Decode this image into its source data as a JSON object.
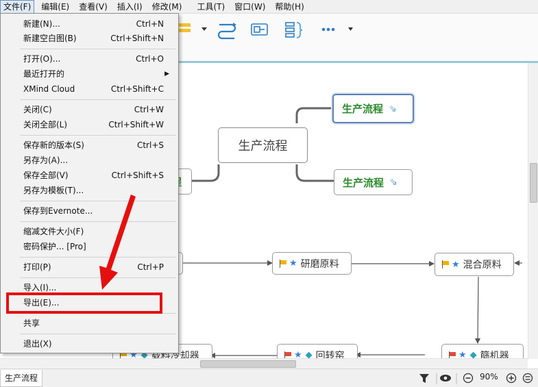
{
  "menubar": {
    "items": [
      "文件(F)",
      "编辑(E)",
      "查看(V)",
      "插入(I)",
      "修改(M)",
      "工具(T)",
      "窗口(W)",
      "帮助(H)"
    ]
  },
  "file_menu": {
    "items": [
      {
        "label": "新建(N)...",
        "shortcut": "Ctrl+N"
      },
      {
        "label": "新建空白图(B)",
        "shortcut": "Ctrl+Shift+N"
      },
      {
        "label": "打开(O)...",
        "shortcut": "Ctrl+O"
      },
      {
        "label": "最近打开的",
        "shortcut": ""
      },
      {
        "label": "XMind Cloud",
        "shortcut": "Ctrl+Shift+C"
      },
      {
        "label": "关闭(C)",
        "shortcut": "Ctrl+W"
      },
      {
        "label": "关闭全部(L)",
        "shortcut": "Ctrl+Shift+W"
      },
      {
        "label": "保存新的版本(S)",
        "shortcut": "Ctrl+S"
      },
      {
        "label": "另存为(A)...",
        "shortcut": ""
      },
      {
        "label": "保存全部(V)",
        "shortcut": "Ctrl+Shift+S"
      },
      {
        "label": "另存为模板(T)...",
        "shortcut": ""
      },
      {
        "label": "保存到Evernote...",
        "shortcut": ""
      },
      {
        "label": "缩减文件大小(F)",
        "shortcut": ""
      },
      {
        "label": "密码保护... [Pro]",
        "shortcut": ""
      },
      {
        "label": "打印(P)",
        "shortcut": "Ctrl+P"
      },
      {
        "label": "导入(I)...",
        "shortcut": ""
      },
      {
        "label": "导出(E)...",
        "shortcut": ""
      },
      {
        "label": "共享",
        "shortcut": ""
      },
      {
        "label": "退出(X)",
        "shortcut": ""
      }
    ]
  },
  "mindmap": {
    "central_topic": "生产流程",
    "subtopic_top": "生产流程",
    "subtopic_bottom": "生产流程",
    "left_partial": "程",
    "flow_nodes": [
      "研磨原料",
      "混合原料",
      "载料冷却器",
      "回转窑",
      "篩机器"
    ]
  },
  "statusbar": {
    "sheet_tab": "生产流程",
    "zoom": "90%"
  },
  "colors": {
    "accent": "#9ac8d6",
    "highlight_red": "#e60f0f",
    "subtopic_green": "#2c8a2c"
  }
}
